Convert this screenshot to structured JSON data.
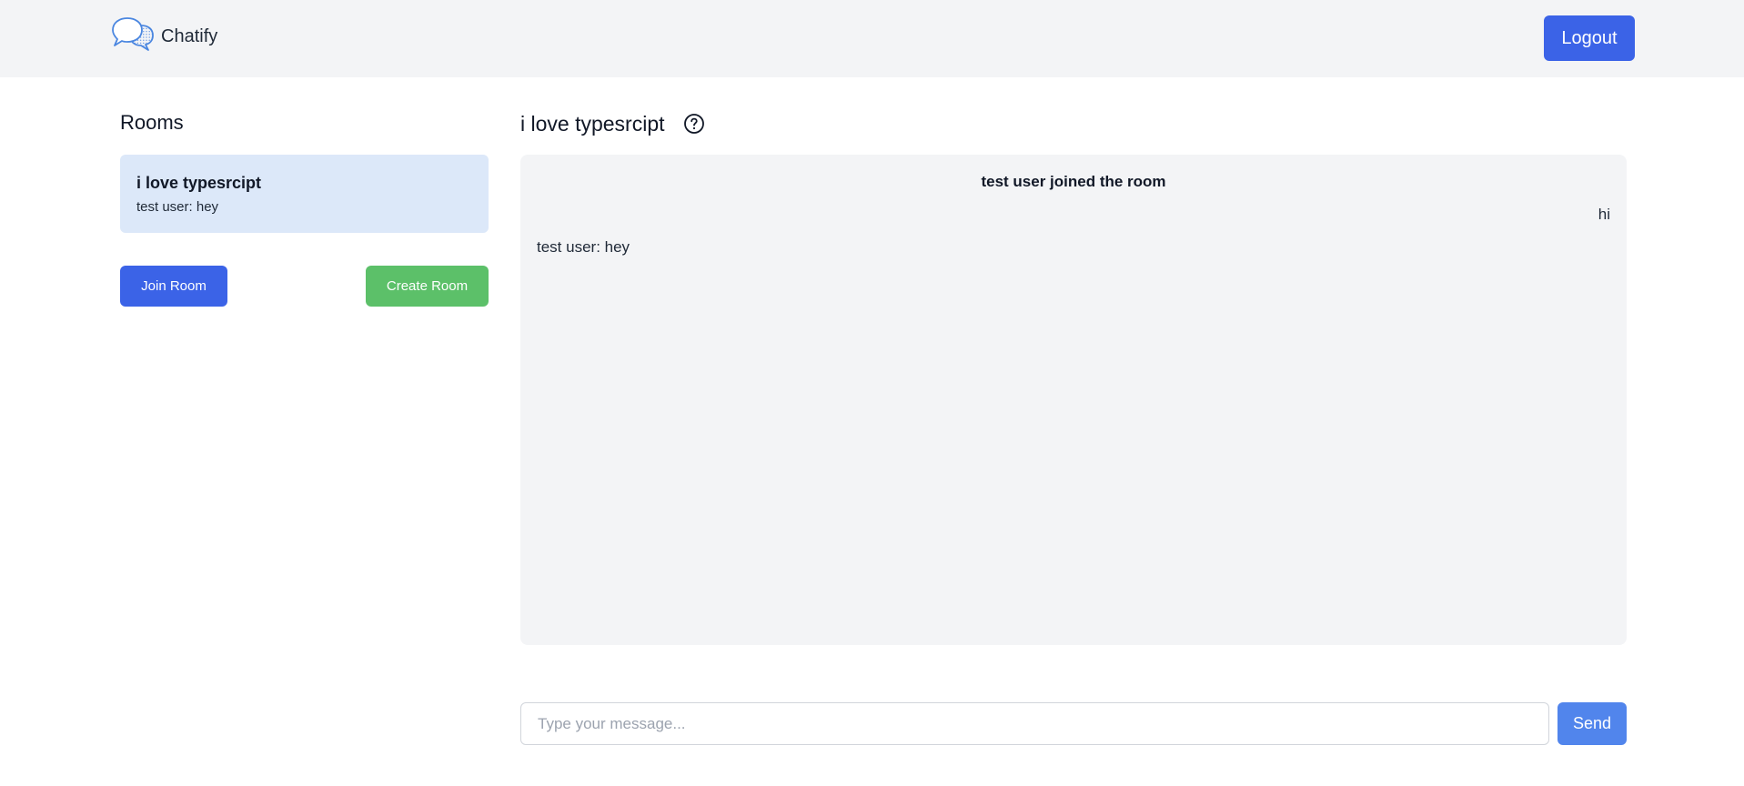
{
  "header": {
    "app_name": "Chatify",
    "logo_icon": "chat-bubbles-icon",
    "logout_label": "Logout"
  },
  "sidebar": {
    "title": "Rooms",
    "rooms": [
      {
        "name": "i love typesrcipt",
        "preview": "test user: hey",
        "selected": true
      }
    ],
    "join_label": "Join Room",
    "create_label": "Create Room"
  },
  "chat": {
    "title": "i love typesrcipt",
    "help_icon": "question-circle-icon",
    "messages": [
      {
        "kind": "system",
        "text": "test user joined the room"
      },
      {
        "kind": "own",
        "text": "hi"
      },
      {
        "kind": "other",
        "text": "test user: hey"
      }
    ]
  },
  "composer": {
    "placeholder": "Type your message...",
    "value": "",
    "send_label": "Send"
  },
  "colors": {
    "header_bg": "#f3f4f6",
    "primary": "#3b63e7",
    "create_green": "#5cc069",
    "send_blue": "#5185ec",
    "room_selected_bg": "#dce8f9",
    "chat_bg": "#f3f4f6"
  }
}
